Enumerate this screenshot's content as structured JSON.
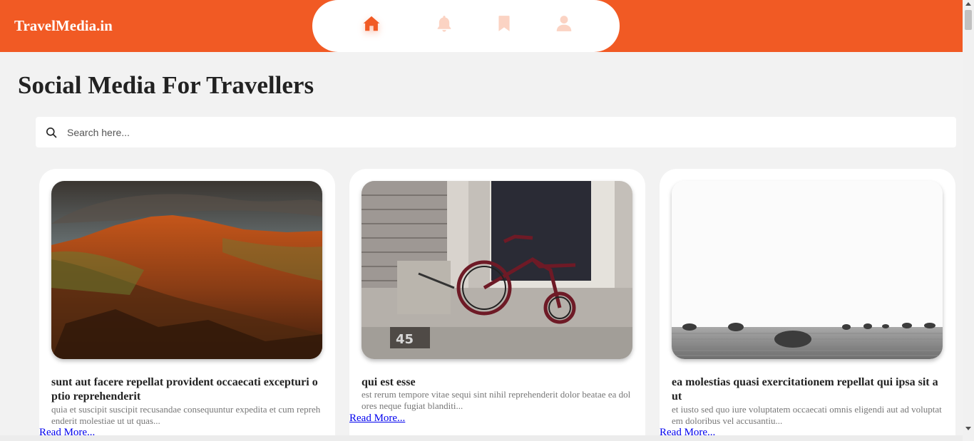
{
  "header": {
    "brand": "TravelMedia.in",
    "nav": [
      {
        "name": "home",
        "icon": "home-icon",
        "active": true
      },
      {
        "name": "notifications",
        "icon": "bell-icon",
        "active": false
      },
      {
        "name": "bookmarks",
        "icon": "bookmark-icon",
        "active": false
      },
      {
        "name": "profile",
        "icon": "user-icon",
        "active": false
      }
    ]
  },
  "page": {
    "title": "Social Media For Travellers"
  },
  "search": {
    "placeholder": "Search here...",
    "value": "",
    "icon": "search-icon"
  },
  "posts": [
    {
      "title": "sunt aut facere repellat provident occaecati excepturi optio reprehenderit",
      "body": "quia et suscipit suscipit recusandae consequuntur expedita et cum reprehenderit molestiae ut ut quas...",
      "read_more": "Read More..."
    },
    {
      "title": "qui est esse",
      "body": "est rerum tempore vitae sequi sint nihil reprehenderit dolor beatae ea dolores neque fugiat blanditi...",
      "read_more": "Read More..."
    },
    {
      "title": "ea molestias quasi exercitationem repellat qui ipsa sit aut",
      "body": "et iusto sed quo iure voluptatem occaecati omnis eligendi aut ad voluptatem doloribus vel accusantiu...",
      "read_more": "Read More..."
    }
  ],
  "colors": {
    "accent": "#f15a24",
    "accent_light": "#fbd3c3",
    "background": "#f2f2f2",
    "link": "#0000ee"
  }
}
